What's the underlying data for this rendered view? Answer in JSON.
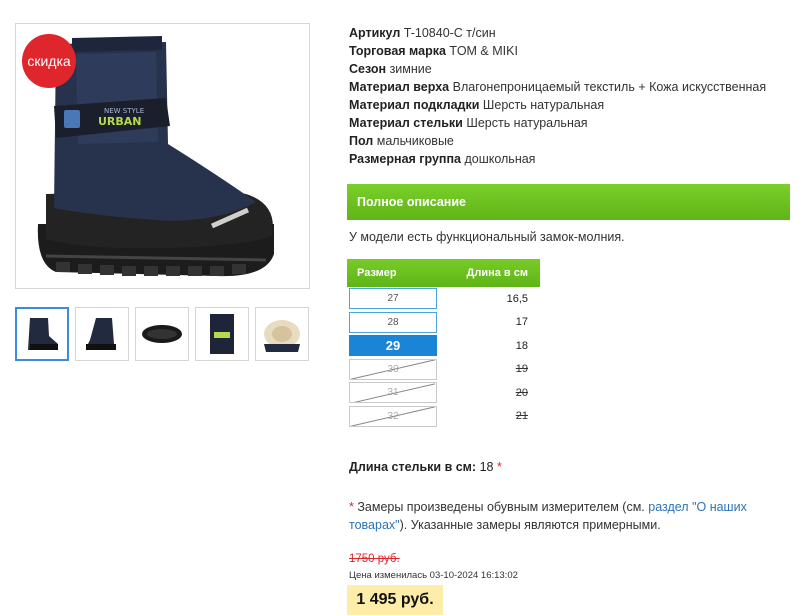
{
  "product": {
    "sale_badge": "скидка",
    "attributes": [
      {
        "key": "Артикул",
        "value": "T-10840-C т/син"
      },
      {
        "key": "Торговая марка",
        "value": "TOM & MIKI"
      },
      {
        "key": "Сезон",
        "value": "зимние"
      },
      {
        "key": "Материал верха",
        "value": "Влагонепроницаемый текстиль + Кожа искусственная"
      },
      {
        "key": "Материал подкладки",
        "value": "Шерсть натуральная"
      },
      {
        "key": "Материал стельки",
        "value": "Шерсть натуральная"
      },
      {
        "key": "Пол",
        "value": "мальчиковые"
      },
      {
        "key": "Размерная группа",
        "value": "дошкольная"
      }
    ],
    "full_description_label": "Полное описание",
    "description": "У модели есть функциональный замок-молния.",
    "boot_label_top": "NEW STYLE",
    "boot_label_main": "URBAN"
  },
  "sizes": {
    "header_size": "Размер",
    "header_length": "Длина в см",
    "rows": [
      {
        "size": "27",
        "length": "16,5",
        "state": "available"
      },
      {
        "size": "28",
        "length": "17",
        "state": "available"
      },
      {
        "size": "29",
        "length": "18",
        "state": "selected"
      },
      {
        "size": "30",
        "length": "19",
        "state": "unavailable"
      },
      {
        "size": "31",
        "length": "20",
        "state": "unavailable"
      },
      {
        "size": "32",
        "length": "21",
        "state": "unavailable"
      }
    ]
  },
  "insole": {
    "label": "Длина стельки в см:",
    "value": "18",
    "star": "*"
  },
  "note": {
    "star": "*",
    "text_before": " Замеры произведены обувным измерителем (см. ",
    "link": "раздел \"О наших товарах\"",
    "text_after": "). Указанные замеры являются примерными."
  },
  "price": {
    "old": "1750 руб.",
    "changed": "Цена изменилась 03-10-2024 16:13:02",
    "current": "1 495 руб."
  },
  "colors": {
    "accent_green": "#6cc120",
    "selected_blue": "#1a84d6",
    "sale_red": "#e0262d",
    "price_bg": "#fdeda8"
  }
}
